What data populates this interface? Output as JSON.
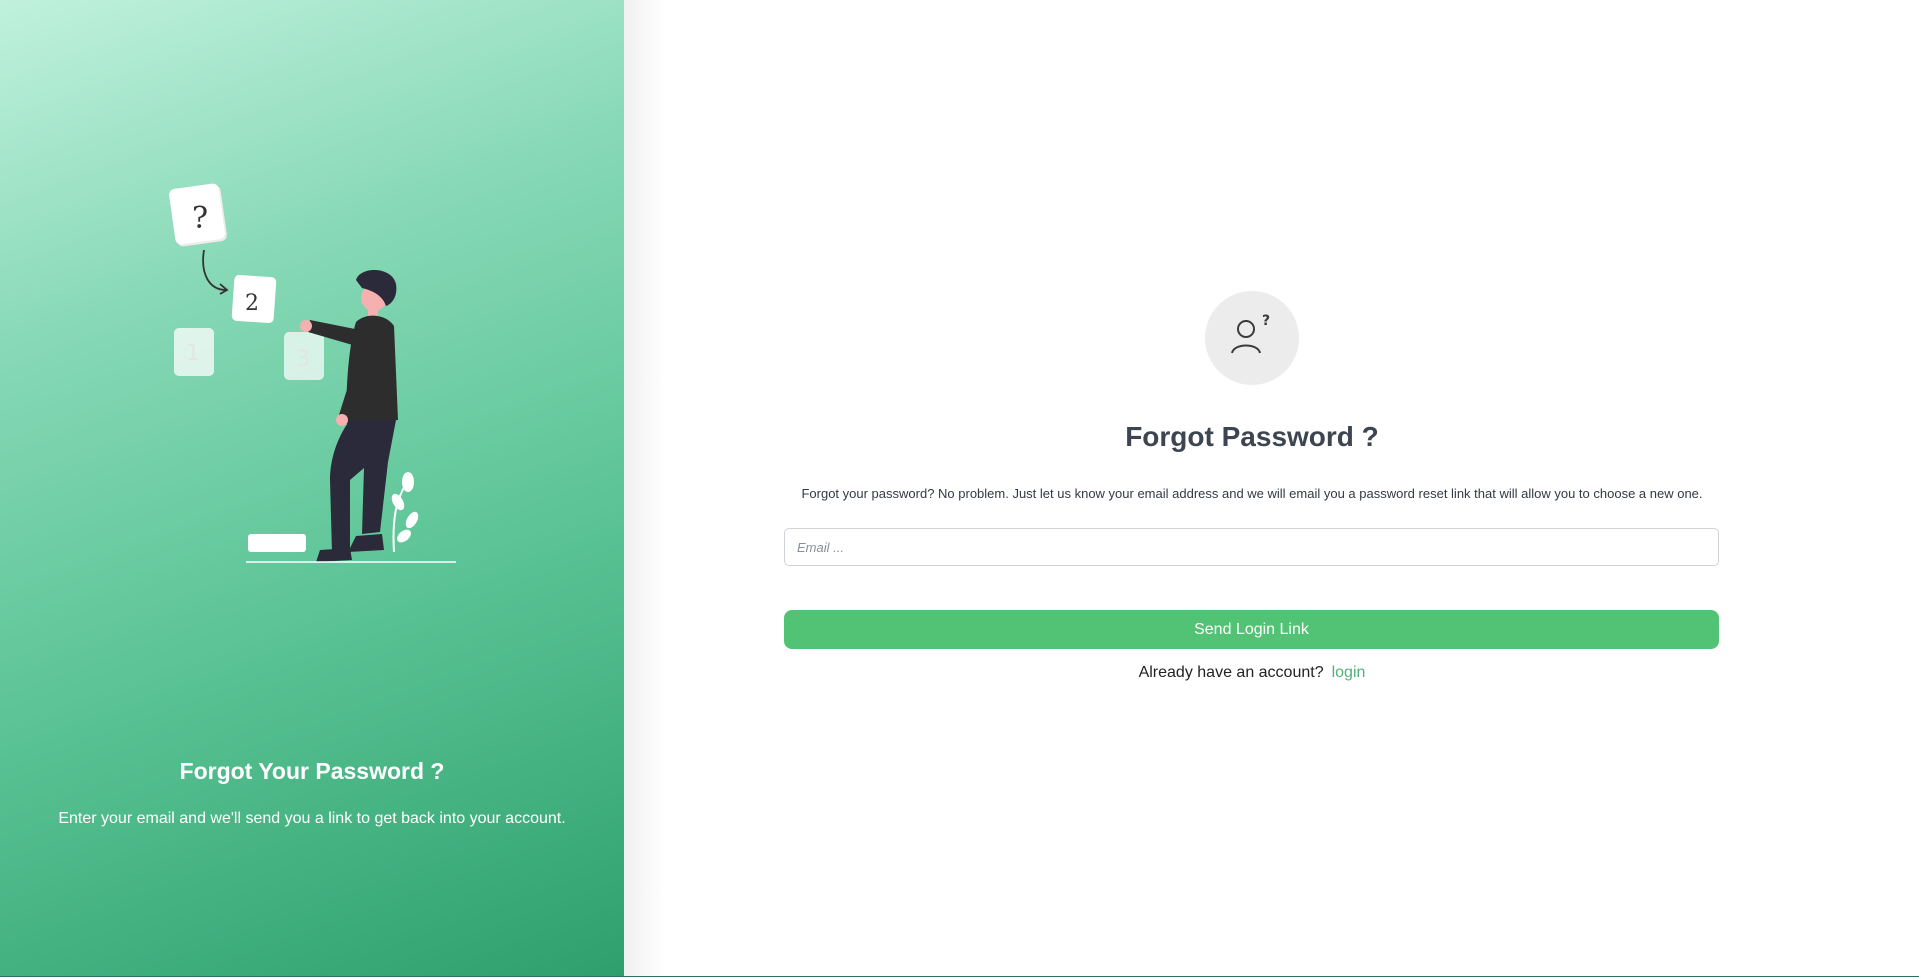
{
  "left_panel": {
    "title": "Forgot Your Password ?",
    "subtitle": "Enter your email and we'll send you a link to get back into your account.",
    "illustration": {
      "notes": [
        "?",
        "2",
        "1",
        "3"
      ]
    }
  },
  "form": {
    "icon": "user-question-icon",
    "title": "Forgot Password ?",
    "description": "Forgot your password? No problem. Just let us know your email address and we will email you a password reset link that will allow you to choose a new one.",
    "email_placeholder": "Email ...",
    "email_value": "",
    "submit_label": "Send Login Link",
    "login_prompt": "Already have an account?",
    "login_link": "login"
  },
  "colors": {
    "accent": "#52c374",
    "panel_gradient_start": "#c0f1dd",
    "panel_gradient_end": "#2ea06d",
    "heading": "#3d4550",
    "link": "#52b07a"
  }
}
